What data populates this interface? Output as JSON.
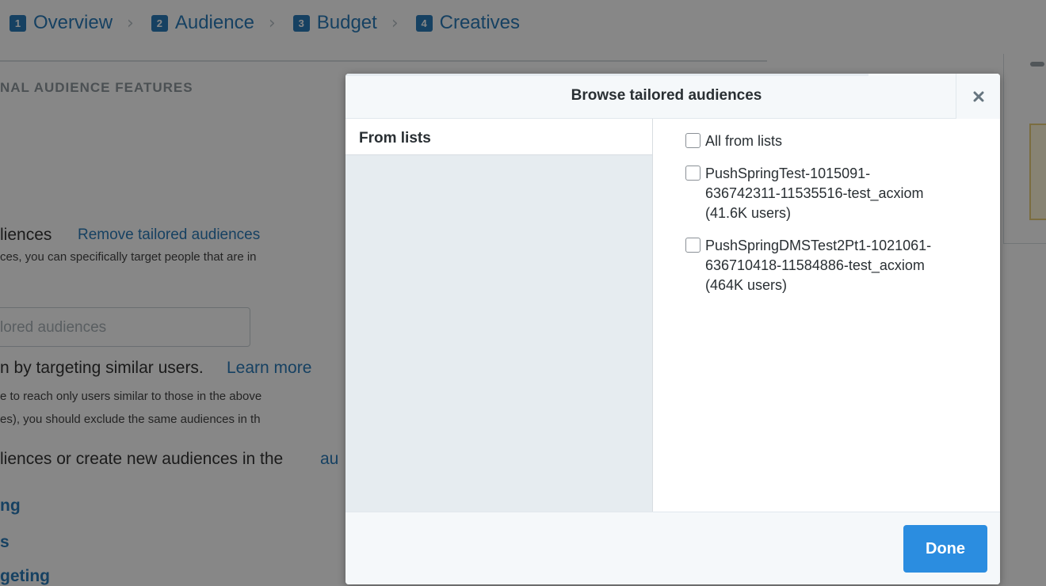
{
  "steps": [
    {
      "num": "1",
      "label": "Overview"
    },
    {
      "num": "2",
      "label": "Audience"
    },
    {
      "num": "3",
      "label": "Budget"
    },
    {
      "num": "4",
      "label": "Creatives"
    }
  ],
  "background": {
    "section_heading": "NAL AUDIENCE FEATURES",
    "audiences_title": "liences",
    "remove_link": "Remove tailored audiences",
    "description": "ces, you can specifically target people that are in",
    "input_placeholder": "lored audiences",
    "expand_text": "n by targeting similar users.",
    "learn_more": "Learn more",
    "desc_line2": "e to reach only users similar to those in the above",
    "desc_line3": "es), you should exclude the same audiences in th",
    "manage_text": "liences or create new audiences in the",
    "manage_link": "au",
    "link_a": "ng",
    "link_b": "s",
    "link_c": "geting"
  },
  "modal": {
    "title": "Browse tailored audiences",
    "close_icon": "close-icon",
    "left_label": "From lists",
    "options": [
      {
        "label": "All from lists",
        "checked": false
      },
      {
        "label": "PushSpringTest-1015091-\n636742311-11535516-test_acxiom\n(41.6K users)",
        "checked": false
      },
      {
        "label": "PushSpringDMSTest2Pt1-1021061-\n636710418-11584886-test_acxiom\n(464K users)",
        "checked": false
      }
    ],
    "done_label": "Done"
  },
  "colors": {
    "accent": "#2b7bb9",
    "done_button": "#2b8de0"
  }
}
